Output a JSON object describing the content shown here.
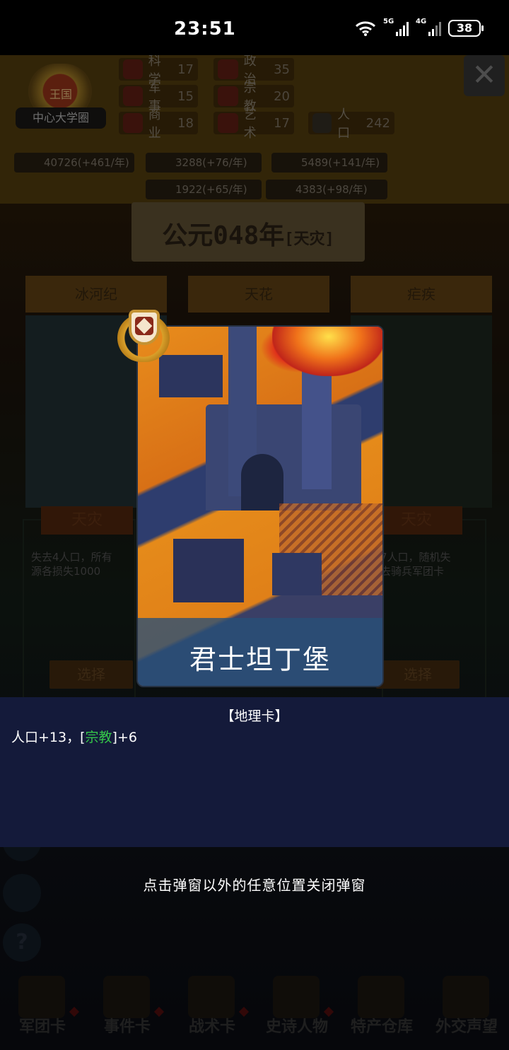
{
  "status_bar": {
    "time": "23:51",
    "network_1": "5G",
    "network_2": "4G",
    "battery": "38"
  },
  "header": {
    "kingdom_name": "王国",
    "capital": "中心大学圈",
    "close_icon": "close-icon",
    "stats": [
      {
        "label": "科学",
        "value": "17"
      },
      {
        "label": "政治",
        "value": "35"
      },
      {
        "label": "军事",
        "value": "15"
      },
      {
        "label": "宗教",
        "value": "20"
      },
      {
        "label": "商业",
        "value": "18"
      },
      {
        "label": "艺术",
        "value": "17"
      },
      {
        "label": "人口",
        "value": "242"
      }
    ],
    "resources": [
      "40726(+461/年)",
      "3288(+76/年)",
      "5489(+141/年)",
      "1922(+65/年)",
      "4383(+98/年)"
    ]
  },
  "year_banner": {
    "year": "公元048年",
    "tag": "[天灾]"
  },
  "cards": [
    {
      "tab": "冰河纪",
      "label": "天灾",
      "desc_line1": "失去4人口，所有",
      "desc_line2": "源各损失1000",
      "choose": "选择"
    },
    {
      "tab": "天花",
      "label": "",
      "desc_line1": "",
      "desc_line2": "",
      "choose": ""
    },
    {
      "tab": "疟疾",
      "label": "天灾",
      "desc_line1": "7人口，随机失",
      "desc_line2": "去骑兵军团卡",
      "choose": "选择"
    }
  ],
  "popup": {
    "card_title": "君士坦丁堡",
    "card_type": "【地理卡】",
    "effect_prefix": "人口+13，[",
    "effect_highlight": "宗教",
    "effect_suffix": "]+6",
    "highlight_color": "#35c64a"
  },
  "dismiss_hint": "点击弹窗以外的任意位置关闭弹窗",
  "bottom_nav": [
    {
      "label": "军团卡",
      "icon": "helmet-icon"
    },
    {
      "label": "事件卡",
      "icon": "scroll-icon"
    },
    {
      "label": "战术卡",
      "icon": "swords-icon"
    },
    {
      "label": "史诗人物",
      "icon": "crown-icon"
    },
    {
      "label": "特产仓库",
      "icon": "chest-icon"
    },
    {
      "label": "外交声望",
      "icon": "letter-icon"
    }
  ]
}
